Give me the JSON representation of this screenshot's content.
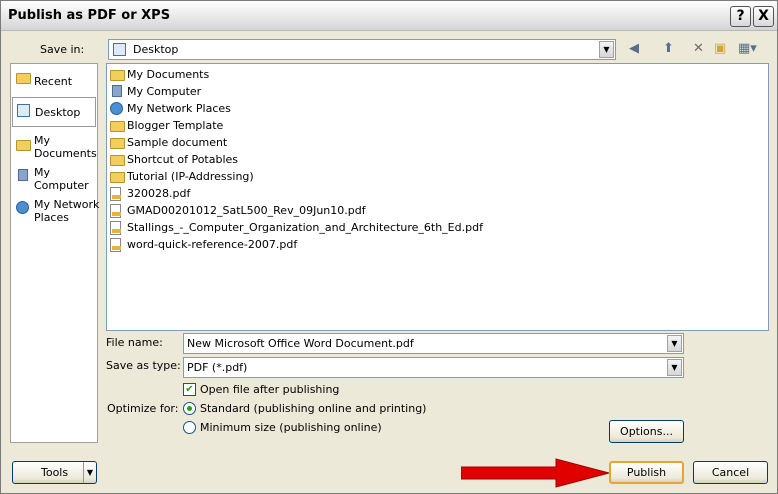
{
  "window": {
    "title": "Publish as PDF or XPS",
    "help_glyph": "?",
    "close_glyph": "X"
  },
  "save_in": {
    "label": "Save in:",
    "value": "Desktop"
  },
  "places": [
    {
      "label": "Recent",
      "icon": "folder-icon"
    },
    {
      "label": "Desktop",
      "icon": "desktop-icon",
      "selected": true
    },
    {
      "label": "My\nDocuments",
      "icon": "documents-icon"
    },
    {
      "label": "My\nComputer",
      "icon": "computer-icon"
    },
    {
      "label": "My Network\nPlaces",
      "icon": "network-icon"
    }
  ],
  "files": [
    {
      "name": "My Documents",
      "icon": "documents-icon"
    },
    {
      "name": "My Computer",
      "icon": "computer-icon"
    },
    {
      "name": "My Network Places",
      "icon": "network-icon"
    },
    {
      "name": "Blogger Template",
      "icon": "folder-icon"
    },
    {
      "name": "Sample document",
      "icon": "folder-icon"
    },
    {
      "name": "Shortcut of Potables",
      "icon": "folder-icon"
    },
    {
      "name": "Tutorial (IP-Addressing)",
      "icon": "folder-icon"
    },
    {
      "name": "320028.pdf",
      "icon": "pdf-icon"
    },
    {
      "name": "GMAD00201012_SatL500_Rev_09Jun10.pdf",
      "icon": "pdf-icon"
    },
    {
      "name": "Stallings_-_Computer_Organization_and_Architecture_6th_Ed.pdf",
      "icon": "pdf-icon"
    },
    {
      "name": "word-quick-reference-2007.pdf",
      "icon": "pdf-icon"
    }
  ],
  "file_name": {
    "label": "File name:",
    "value": "New Microsoft Office Word Document.pdf"
  },
  "save_as_type": {
    "label": "Save as type:",
    "value": "PDF (*.pdf)"
  },
  "open_after": {
    "label": "Open file after publishing",
    "checked": true
  },
  "optimize": {
    "label": "Optimize for:",
    "standard": "Standard (publishing online and printing)",
    "minimum": "Minimum size (publishing online)",
    "selected": "standard"
  },
  "buttons": {
    "options": "Options...",
    "tools": "Tools",
    "publish": "Publish",
    "cancel": "Cancel"
  },
  "colors": {
    "accent": "#e7a43b",
    "arrow": "#e00000"
  }
}
